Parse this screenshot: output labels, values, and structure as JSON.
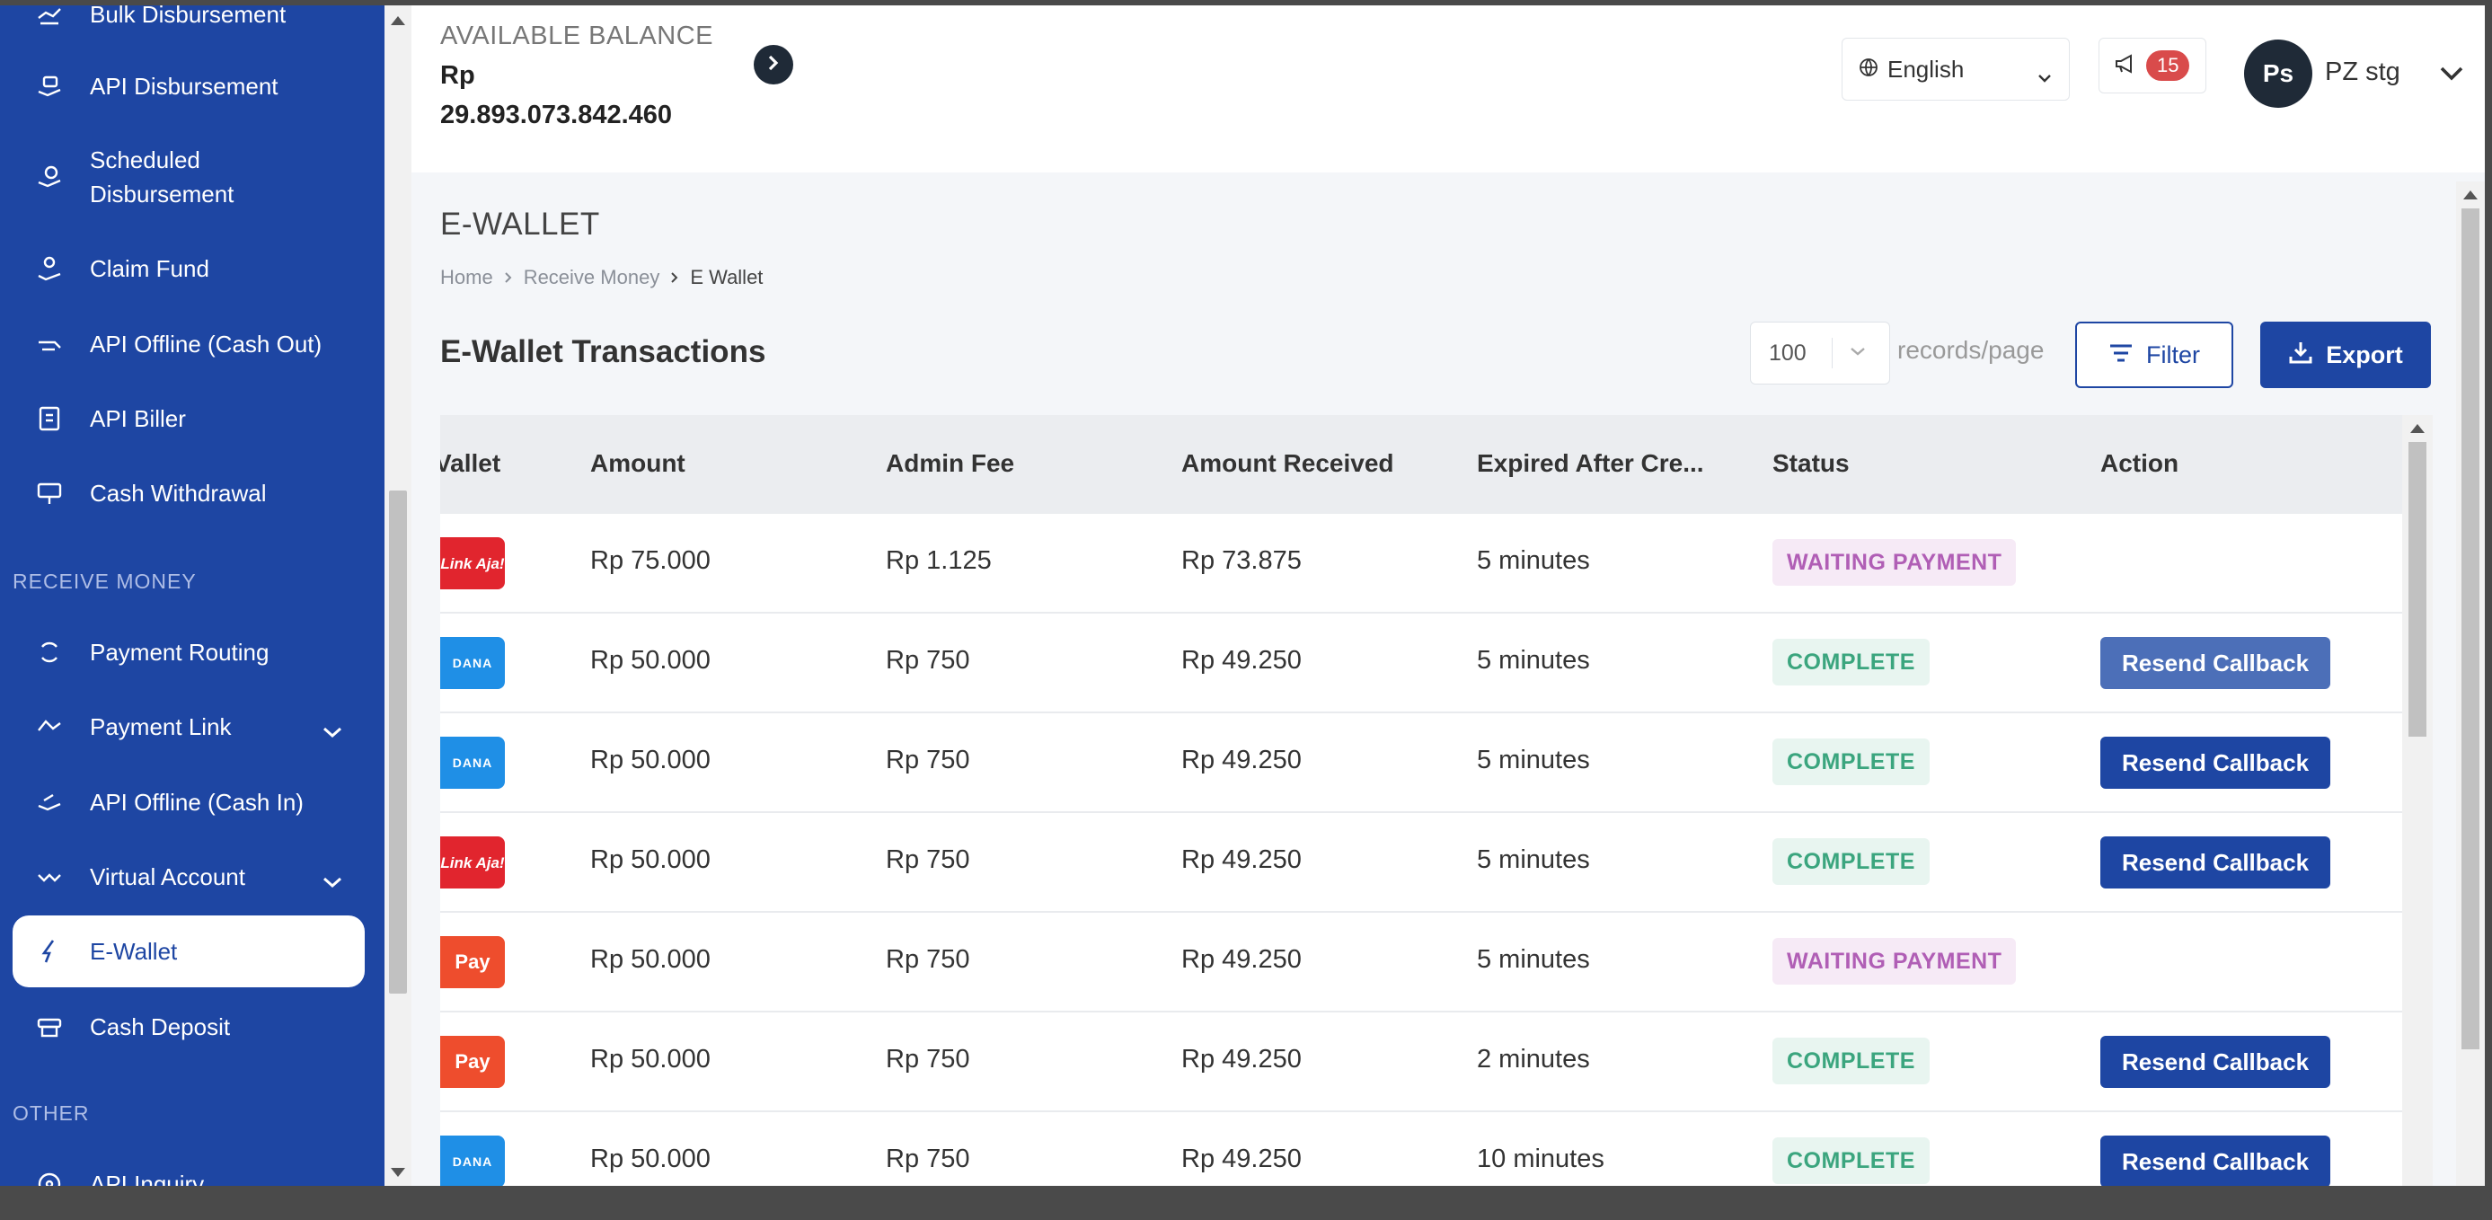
{
  "sidebar": {
    "items_top": [
      {
        "label": "Bulk Disbursement",
        "icon": "bulk-disbursement-icon"
      },
      {
        "label": "API Disbursement",
        "icon": "api-disbursement-icon"
      },
      {
        "label": "Scheduled",
        "label2": "Disbursement",
        "icon": "scheduled-disbursement-icon"
      },
      {
        "label": "Claim Fund",
        "icon": "claim-fund-icon"
      },
      {
        "label": "API Offline (Cash Out)",
        "icon": "api-offline-cash-out-icon"
      },
      {
        "label": "API Biller",
        "icon": "api-biller-icon"
      },
      {
        "label": "Cash Withdrawal",
        "icon": "cash-withdrawal-icon"
      }
    ],
    "section_receive": "RECEIVE MONEY",
    "items_receive": [
      {
        "label": "Payment Routing",
        "icon": "payment-routing-icon"
      },
      {
        "label": "Payment Link",
        "icon": "payment-link-icon",
        "expandable": true
      },
      {
        "label": "API Offline (Cash In)",
        "icon": "api-offline-cash-in-icon"
      },
      {
        "label": "Virtual Account",
        "icon": "virtual-account-icon",
        "expandable": true
      },
      {
        "label": "E-Wallet",
        "icon": "e-wallet-icon",
        "active": true
      },
      {
        "label": "Cash Deposit",
        "icon": "cash-deposit-icon"
      }
    ],
    "section_other": "OTHER",
    "items_other": [
      {
        "label": "API Inquiry",
        "icon": "api-inquiry-icon"
      }
    ]
  },
  "header": {
    "balance_title": "AVAILABLE BALANCE",
    "balance_currency": "Rp",
    "balance_value": "29.893.073.842.460",
    "language": "English",
    "notifications": "15",
    "avatar_initials": "Ps",
    "user_name": "PZ stg"
  },
  "page": {
    "title": "E-WALLET",
    "breadcrumb": [
      "Home",
      "Receive Money",
      "E Wallet"
    ],
    "section_title": "E-Wallet Transactions",
    "records_per_page": "100",
    "records_label": "records/page",
    "filter_label": "Filter",
    "export_label": "Export"
  },
  "table": {
    "columns": [
      "Wallet",
      "Amount",
      "Admin Fee",
      "Amount Received",
      "Expired After Cre...",
      "Status",
      "Action"
    ],
    "columns_visible": [
      "Vallet",
      "Amount",
      "Admin Fee",
      "Amount Received",
      "Expired After Cre...",
      "Status",
      "Action"
    ],
    "rows": [
      {
        "wallet": "LinkAja",
        "logo_text": "Link Aja!",
        "amount": "Rp 75.000",
        "admin_fee": "Rp 1.125",
        "received": "Rp 73.875",
        "expired": "5 minutes",
        "status": "WAITING PAYMENT",
        "action": ""
      },
      {
        "wallet": "DANA",
        "logo_text": "DANA",
        "amount": "Rp 50.000",
        "admin_fee": "Rp 750",
        "received": "Rp 49.250",
        "expired": "5 minutes",
        "status": "COMPLETE",
        "action": "Resend Callback"
      },
      {
        "wallet": "DANA",
        "logo_text": "DANA",
        "amount": "Rp 50.000",
        "admin_fee": "Rp 750",
        "received": "Rp 49.250",
        "expired": "5 minutes",
        "status": "COMPLETE",
        "action": "Resend Callback"
      },
      {
        "wallet": "LinkAja",
        "logo_text": "Link Aja!",
        "amount": "Rp 50.000",
        "admin_fee": "Rp 750",
        "received": "Rp 49.250",
        "expired": "5 minutes",
        "status": "COMPLETE",
        "action": "Resend Callback"
      },
      {
        "wallet": "ShopeePay",
        "logo_text": "Pay",
        "amount": "Rp 50.000",
        "admin_fee": "Rp 750",
        "received": "Rp 49.250",
        "expired": "5 minutes",
        "status": "WAITING PAYMENT",
        "action": ""
      },
      {
        "wallet": "ShopeePay",
        "logo_text": "Pay",
        "amount": "Rp 50.000",
        "admin_fee": "Rp 750",
        "received": "Rp 49.250",
        "expired": "2 minutes",
        "status": "COMPLETE",
        "action": "Resend Callback"
      },
      {
        "wallet": "DANA",
        "logo_text": "DANA",
        "amount": "Rp 50.000",
        "admin_fee": "Rp 750",
        "received": "Rp 49.250",
        "expired": "10 minutes",
        "status": "COMPLETE",
        "action": "Resend Callback"
      }
    ]
  },
  "colors": {
    "brand": "#1e46a3",
    "complete": "#3ba57e",
    "waiting": "#b05eb5",
    "badge": "#d94b4b"
  }
}
